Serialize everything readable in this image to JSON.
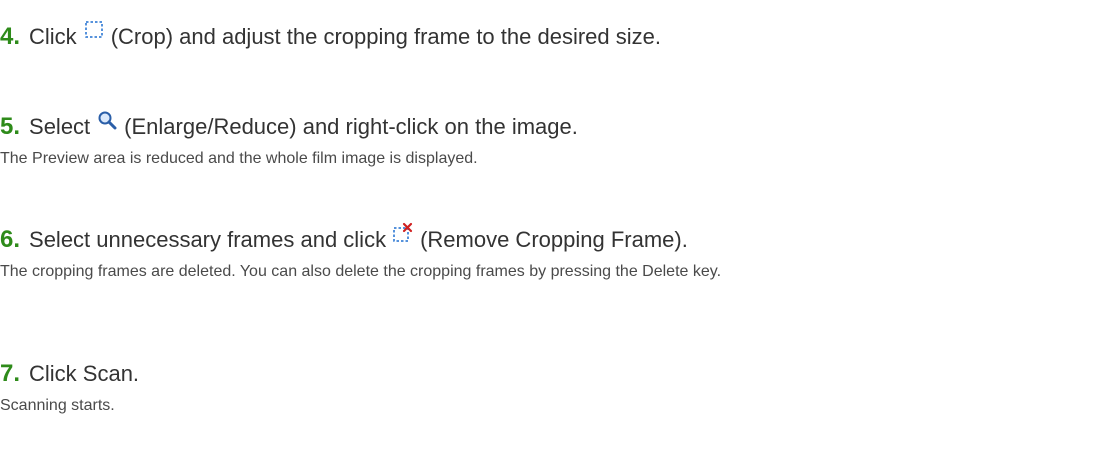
{
  "steps": [
    {
      "number": "4.",
      "before_icon": "Click",
      "icon": "crop-icon",
      "after_icon": "(Crop) and adjust the cropping frame to the desired size.",
      "description": ""
    },
    {
      "number": "5.",
      "before_icon": "Select",
      "icon": "magnifier-icon",
      "after_icon": "(Enlarge/Reduce) and right-click on the image.",
      "description": "The Preview area is reduced and the whole film image is displayed."
    },
    {
      "number": "6.",
      "before_icon": "Select unnecessary frames and click",
      "icon": "remove-cropping-frame-icon",
      "after_icon": "(Remove Cropping Frame).",
      "description": "The cropping frames are deleted. You can also delete the cropping frames by pressing the Delete key."
    },
    {
      "number": "7.",
      "text": "Click Scan.",
      "description": "Scanning starts."
    }
  ],
  "colors": {
    "step_number": "#2e8b1a",
    "text": "#333333",
    "icon_blue": "#1f6fd0",
    "icon_red": "#d02020"
  }
}
